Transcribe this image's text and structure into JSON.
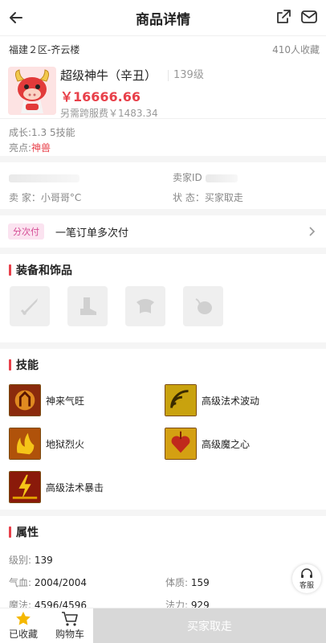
{
  "header": {
    "title": "商品详情"
  },
  "server": {
    "name": "福建２区-齐云楼",
    "favorites": "410人收藏"
  },
  "product": {
    "name": "超级神牛（辛丑）",
    "level": "139级",
    "price": "￥16666.66",
    "extra_fee": "另需跨服费￥1483.34"
  },
  "growth": {
    "text": "成长:1.3 5技能",
    "highlight_label": "亮点:",
    "highlight_value": "神兽"
  },
  "seller": {
    "id_label": "卖家ID",
    "seller_label": "卖 家：",
    "seller_name": "小哥哥°C",
    "status_label": "状 态：",
    "status_value": "买家取走"
  },
  "payment": {
    "tag": "分次付",
    "text": "一笔订单多次付"
  },
  "equipment": {
    "title": "装备和饰品"
  },
  "skills": {
    "title": "技能",
    "items": [
      {
        "name": "神来气旺",
        "icon": "god-spirit-icon"
      },
      {
        "name": "高级法术波动",
        "icon": "magic-wave-icon"
      },
      {
        "name": "地狱烈火",
        "icon": "hell-fire-icon"
      },
      {
        "name": "高级魔之心",
        "icon": "magic-heart-icon"
      },
      {
        "name": "高级法术暴击",
        "icon": "magic-crit-icon"
      }
    ]
  },
  "attributes": {
    "title": "属性",
    "level_label": "级别:",
    "level_value": "139",
    "hp_label": "气血:",
    "hp_value": "2004/2004",
    "con_label": "体质:",
    "con_value": "159",
    "mp_label": "魔法:",
    "mp_value": "4596/4596",
    "mag_label": "法力:",
    "mag_value": "929"
  },
  "service": {
    "label": "客服"
  },
  "bottom": {
    "fav_label": "已收藏",
    "cart_label": "购物车",
    "buy_label": "买家取走"
  },
  "colors": {
    "accent": "#e8404a",
    "tag_bg": "#fbe3f0",
    "disabled": "#d8d8d8"
  }
}
